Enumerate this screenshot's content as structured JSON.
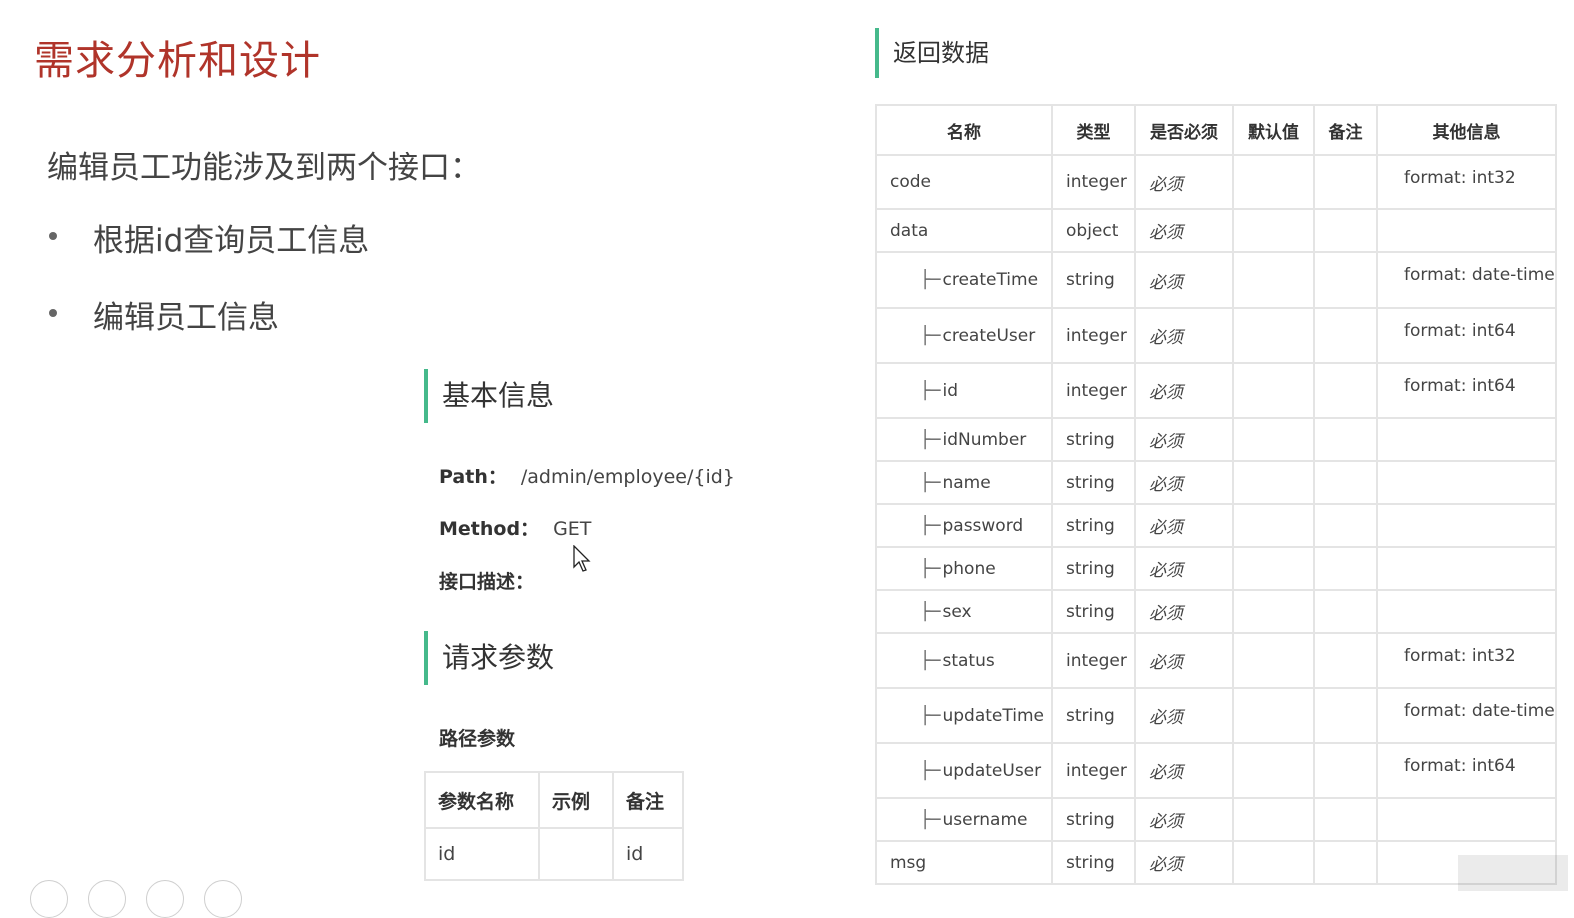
{
  "slide": {
    "title": "需求分析和设计",
    "intro": "编辑员工功能涉及到两个接口：",
    "bullets": [
      "根据id查询员工信息",
      "编辑员工信息"
    ]
  },
  "basic_info": {
    "heading": "基本信息",
    "path_label": "Path：",
    "path_value": "/admin/employee/{id}",
    "method_label": "Method：",
    "method_value": "GET",
    "desc_label": "接口描述："
  },
  "request_params": {
    "heading": "请求参数",
    "sub_heading": "路径参数",
    "columns": [
      "参数名称",
      "示例",
      "备注"
    ],
    "rows": [
      [
        "id",
        "",
        "id"
      ]
    ]
  },
  "return_data": {
    "heading": "返回数据",
    "columns": [
      "名称",
      "类型",
      "是否必须",
      "默认值",
      "备注",
      "其他信息"
    ],
    "rows": [
      {
        "name": "code",
        "nested": false,
        "type": "integer",
        "required": "必须",
        "default": "",
        "note": "",
        "other": "format: int32"
      },
      {
        "name": "data",
        "nested": false,
        "type": "object",
        "required": "必须",
        "default": "",
        "note": "",
        "other": ""
      },
      {
        "name": "createTime",
        "nested": true,
        "type": "string",
        "required": "必须",
        "default": "",
        "note": "",
        "other": "format: date-time"
      },
      {
        "name": "createUser",
        "nested": true,
        "type": "integer",
        "required": "必须",
        "default": "",
        "note": "",
        "other": "format: int64"
      },
      {
        "name": "id",
        "nested": true,
        "type": "integer",
        "required": "必须",
        "default": "",
        "note": "",
        "other": "format: int64"
      },
      {
        "name": "idNumber",
        "nested": true,
        "type": "string",
        "required": "必须",
        "default": "",
        "note": "",
        "other": ""
      },
      {
        "name": "name",
        "nested": true,
        "type": "string",
        "required": "必须",
        "default": "",
        "note": "",
        "other": ""
      },
      {
        "name": "password",
        "nested": true,
        "type": "string",
        "required": "必须",
        "default": "",
        "note": "",
        "other": ""
      },
      {
        "name": "phone",
        "nested": true,
        "type": "string",
        "required": "必须",
        "default": "",
        "note": "",
        "other": ""
      },
      {
        "name": "sex",
        "nested": true,
        "type": "string",
        "required": "必须",
        "default": "",
        "note": "",
        "other": ""
      },
      {
        "name": "status",
        "nested": true,
        "type": "integer",
        "required": "必须",
        "default": "",
        "note": "",
        "other": "format: int32"
      },
      {
        "name": "updateTime",
        "nested": true,
        "type": "string",
        "required": "必须",
        "default": "",
        "note": "",
        "other": "format: date-time"
      },
      {
        "name": "updateUser",
        "nested": true,
        "type": "integer",
        "required": "必须",
        "default": "",
        "note": "",
        "other": "format: int64"
      },
      {
        "name": "username",
        "nested": true,
        "type": "string",
        "required": "必须",
        "default": "",
        "note": "",
        "other": ""
      },
      {
        "name": "msg",
        "nested": false,
        "type": "string",
        "required": "必须",
        "default": "",
        "note": "",
        "other": ""
      }
    ]
  },
  "icons": {
    "tree_branch": "├─",
    "cursor": "mouse-pointer-icon"
  },
  "colors": {
    "title": "#b0342a",
    "section_accent": "#45b98b"
  }
}
